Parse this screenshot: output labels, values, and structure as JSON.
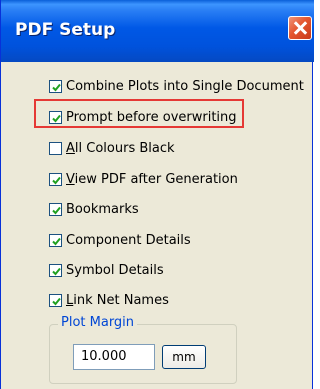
{
  "window": {
    "title": "PDF Setup",
    "close_label": "Close"
  },
  "options": [
    {
      "label": "Combine Plots into Single Document",
      "underline": "",
      "checked": true
    },
    {
      "label": "Prompt before overwriting",
      "underline": "",
      "checked": true,
      "highlighted": true
    },
    {
      "label": "All Colours Black",
      "underline": "A",
      "checked": false
    },
    {
      "label": "View PDF after Generation",
      "underline": "V",
      "checked": true
    },
    {
      "label": "Bookmarks",
      "underline": "",
      "checked": true
    },
    {
      "label": "Component Details",
      "underline": "",
      "checked": true
    },
    {
      "label": "Symbol Details",
      "underline": "",
      "checked": true
    },
    {
      "label": "Link Net Names",
      "underline": "L",
      "checked": true
    }
  ],
  "plot_margin": {
    "group_label": "Plot Margin",
    "value": "10.000",
    "unit_label": "mm"
  },
  "colors": {
    "titlebar": "#0058e6",
    "dialog_bg": "#ece9d8",
    "check": "#21a121",
    "highlight": "#e53935"
  }
}
